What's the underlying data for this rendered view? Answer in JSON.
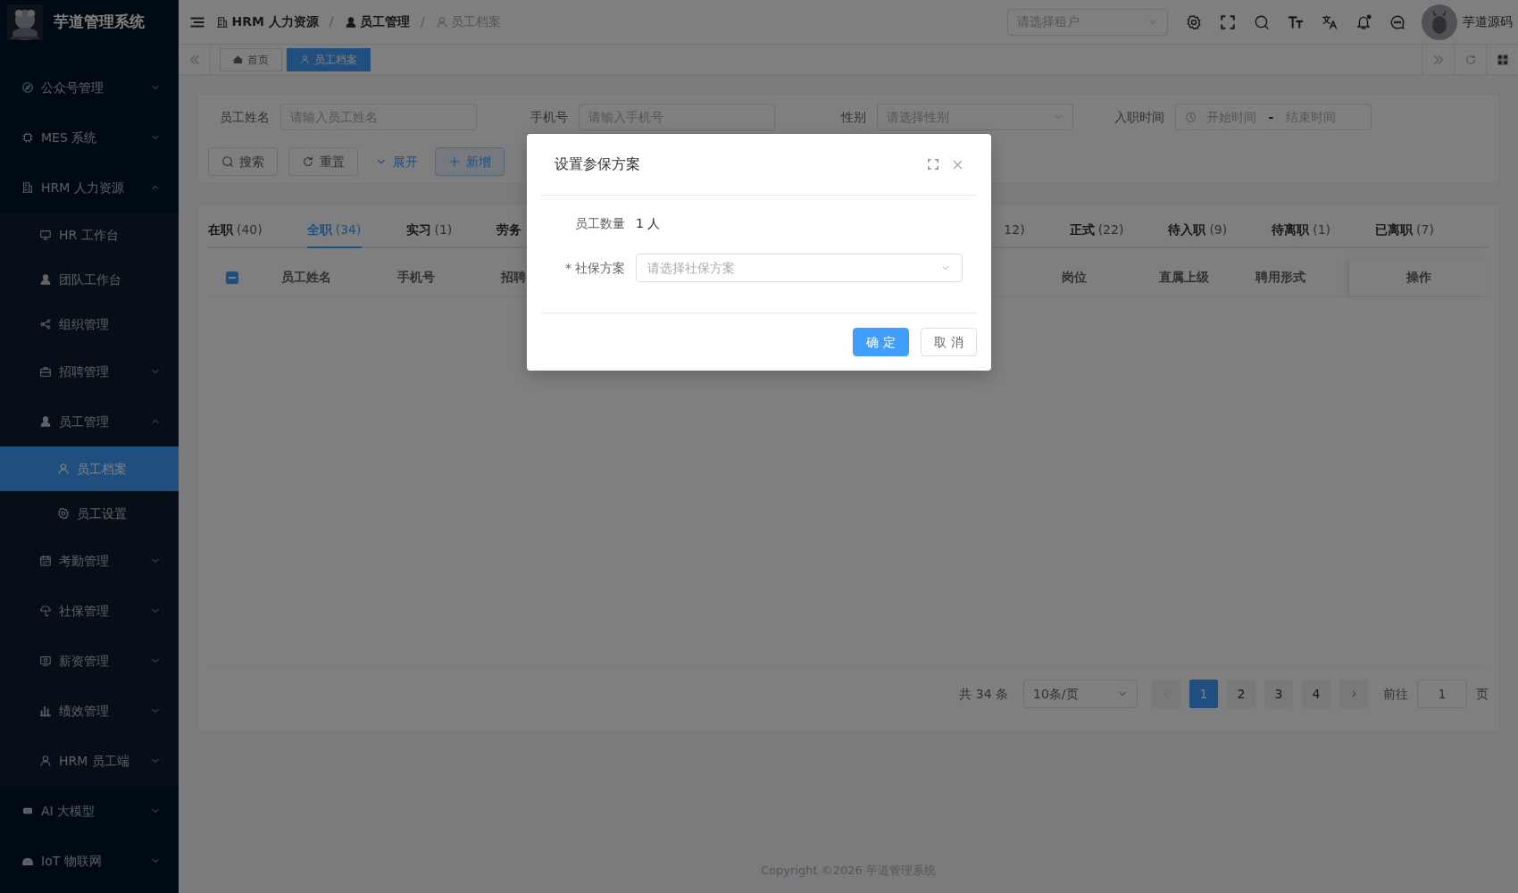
{
  "sidebar": {
    "title": "芋道管理系统",
    "items": [
      {
        "label": "公众号管理",
        "expanded": false,
        "selected": false
      },
      {
        "label": "MES 系统",
        "expanded": false,
        "selected": false
      },
      {
        "label": "HRM 人力资源",
        "expanded": true,
        "selected": false,
        "children": [
          {
            "label": "HR 工作台",
            "selected": false
          },
          {
            "label": "团队工作台",
            "selected": false
          },
          {
            "label": "组织管理",
            "selected": false
          },
          {
            "label": "招聘管理",
            "expanded": false,
            "selected": false
          },
          {
            "label": "员工管理",
            "expanded": true,
            "selected": false,
            "children": [
              {
                "label": "员工档案",
                "selected": true
              },
              {
                "label": "员工设置",
                "selected": false
              }
            ]
          },
          {
            "label": "考勤管理",
            "expanded": false,
            "selected": false
          },
          {
            "label": "社保管理",
            "expanded": false,
            "selected": false
          },
          {
            "label": "薪资管理",
            "expanded": false,
            "selected": false
          },
          {
            "label": "绩效管理",
            "expanded": false,
            "selected": false
          },
          {
            "label": "HRM 员工端",
            "expanded": false,
            "selected": false
          }
        ]
      },
      {
        "label": "AI 大模型",
        "expanded": false,
        "selected": false
      },
      {
        "label": "IoT 物联网",
        "expanded": false,
        "selected": false
      }
    ]
  },
  "header": {
    "breadcrumb": [
      {
        "label": "HRM 人力资源"
      },
      {
        "separator": "/",
        "label": "员工管理"
      },
      {
        "separator": "/",
        "label": "员工档案"
      }
    ],
    "tenant_placeholder": "请选择租户",
    "user": "芋道源码"
  },
  "tags": [
    {
      "label": "首页",
      "selected": false
    },
    {
      "label": "员工档案",
      "selected": true
    }
  ],
  "filters": [
    {
      "kind": "text",
      "label": "员工姓名",
      "placeholder": "请输入员工姓名"
    },
    {
      "kind": "text",
      "label": "手机号",
      "placeholder": "请输入手机号"
    },
    {
      "kind": "select",
      "label": "性别",
      "placeholder": "请选择性别"
    },
    {
      "kind": "daterange",
      "label": "入职时间",
      "start_placeholder": "开始时间",
      "separator": "-",
      "end_placeholder": "结束时间"
    }
  ],
  "filter_buttons": [
    {
      "label": "搜索",
      "kind": "default"
    },
    {
      "label": "重置",
      "kind": "default"
    },
    {
      "label": "展开",
      "kind": "link"
    },
    {
      "label": "新增",
      "kind": "primary-outline"
    }
  ],
  "tabs": [
    {
      "kind": "tab",
      "label": "在职",
      "count": "(40)",
      "selected": false
    },
    {
      "kind": "tab",
      "label": "全职",
      "count": "(34)",
      "selected": true
    },
    {
      "kind": "tab",
      "label": "实习",
      "count": "(1)",
      "selected": false
    },
    {
      "kind": "tab",
      "label": "劳务",
      "selected": false
    },
    {
      "kind": "partial",
      "count": "12)",
      "selected": false
    },
    {
      "kind": "tab",
      "label": "正式",
      "count": "(22)",
      "selected": false
    },
    {
      "kind": "tab",
      "label": "待入职",
      "count": "(9)",
      "selected": false
    },
    {
      "kind": "tab",
      "label": "待离职",
      "count": "(1)",
      "selected": false
    },
    {
      "kind": "tab",
      "label": "已离职",
      "count": "(7)",
      "selected": false
    }
  ],
  "table": {
    "columns": [
      {
        "kind": "checkbox",
        "indeterminate": true
      },
      {
        "kind": "text",
        "label": "员工姓名"
      },
      {
        "kind": "text",
        "label": "手机号"
      },
      {
        "kind": "text",
        "label": "招聘"
      },
      {
        "kind": "text",
        "label": "岗位"
      },
      {
        "kind": "text",
        "label": "直属上级"
      },
      {
        "kind": "text",
        "label": "聘用形式"
      },
      {
        "kind": "text",
        "label": "操作"
      }
    ]
  },
  "pagination": {
    "total": "共 34 条",
    "page_size": "10条/页",
    "pages": [
      {
        "label": "1",
        "selected": true
      },
      {
        "label": "2",
        "selected": false
      },
      {
        "label": "3",
        "selected": false
      },
      {
        "label": "4",
        "selected": false
      }
    ],
    "goto_label": "前往",
    "goto_value": "1",
    "page_suffix": "页"
  },
  "footer": "Copyright ©2026 芋道管理系统",
  "dialog": {
    "title": "设置参保方案",
    "fields": [
      {
        "label": "员工数量",
        "value": "1 人"
      },
      {
        "label": "社保方案",
        "required_mark": "*",
        "placeholder": "请选择社保方案"
      }
    ],
    "buttons": [
      {
        "label": "确 定",
        "kind": "primary"
      },
      {
        "label": "取 消",
        "kind": "default"
      }
    ]
  }
}
